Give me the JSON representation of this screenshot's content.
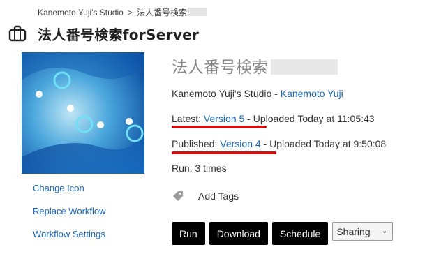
{
  "breadcrumb": {
    "studio": "Kanemoto Yuji's Studio",
    "separator": ">",
    "current": "法人番号検索"
  },
  "page_title": "法人番号検索forServer",
  "workflow": {
    "title": "法人番号検索",
    "owner_prefix": "Kanemoto Yuji's Studio - ",
    "owner_link": "Kanemoto Yuji",
    "latest_label": "Latest: ",
    "latest_version": "Version 5",
    "latest_suffix": " - Uploaded Today at 11:05:43",
    "published_label": "Published: ",
    "published_version": "Version 4",
    "published_suffix": " - Uploaded Today at 9:50:08",
    "run_count": "Run: 3 times"
  },
  "side_links": {
    "change_icon": "Change Icon",
    "replace_workflow": "Replace Workflow",
    "workflow_settings": "Workflow Settings"
  },
  "tags": {
    "add_label": "Add Tags"
  },
  "actions": {
    "run": "Run",
    "download": "Download",
    "schedule": "Schedule",
    "sharing": "Sharing"
  },
  "colors": {
    "link": "#1a66b3",
    "button_bg": "#000000",
    "annotation_underline": "#cc1111"
  },
  "icons": {
    "title": "briefcase-icon",
    "tag": "tag-icon",
    "dropdown": "chevron-down-icon"
  }
}
